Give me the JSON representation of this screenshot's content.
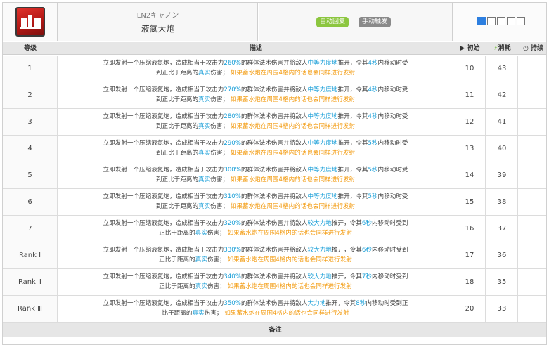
{
  "header": {
    "name_jp": "LN2キャノン",
    "name_cn": "液氮大炮",
    "badge_auto": "自动回复",
    "badge_manual": "手动触发",
    "level_selector": {
      "active": 1,
      "total": 5
    }
  },
  "columns": {
    "level": "等级",
    "description": "描述",
    "initial": "初始",
    "cost": "消耗",
    "duration": "持续"
  },
  "rows": [
    {
      "level": "1",
      "a": "立即发射一个压缩液氮炮，造成相当于攻击力",
      "pct": "260%",
      "b": "的群体法术伤害并将敌人",
      "force": "中等力度地",
      "c": "推开，令其",
      "sec": "4秒",
      "d": "内移动时受",
      "e": "到正比于距离的",
      "true": "真实",
      "f": "伤害；",
      "g": "如果蓄水炮在周围4格内的话也会同样进行发射",
      "initial": "10",
      "cost": "43",
      "duration": ""
    },
    {
      "level": "2",
      "a": "立即发射一个压缩液氮炮，造成相当于攻击力",
      "pct": "270%",
      "b": "的群体法术伤害并将敌人",
      "force": "中等力度地",
      "c": "推开，令其",
      "sec": "4秒",
      "d": "内移动时受",
      "e": "到正比于距离的",
      "true": "真实",
      "f": "伤害；",
      "g": "如果蓄水炮在周围4格内的话也会同样进行发射",
      "initial": "11",
      "cost": "42",
      "duration": ""
    },
    {
      "level": "3",
      "a": "立即发射一个压缩液氮炮，造成相当于攻击力",
      "pct": "280%",
      "b": "的群体法术伤害并将敌人",
      "force": "中等力度地",
      "c": "推开，令其",
      "sec": "4秒",
      "d": "内移动时受",
      "e": "到正比于距离的",
      "true": "真实",
      "f": "伤害；",
      "g": "如果蓄水炮在周围4格内的话也会同样进行发射",
      "initial": "12",
      "cost": "41",
      "duration": ""
    },
    {
      "level": "4",
      "a": "立即发射一个压缩液氮炮，造成相当于攻击力",
      "pct": "290%",
      "b": "的群体法术伤害并将敌人",
      "force": "中等力度地",
      "c": "推开，令其",
      "sec": "5秒",
      "d": "内移动时受",
      "e": "到正比于距离的",
      "true": "真实",
      "f": "伤害；",
      "g": "如果蓄水炮在周围4格内的话也会同样进行发射",
      "initial": "13",
      "cost": "40",
      "duration": ""
    },
    {
      "level": "5",
      "a": "立即发射一个压缩液氮炮，造成相当于攻击力",
      "pct": "300%",
      "b": "的群体法术伤害并将敌人",
      "force": "中等力度地",
      "c": "推开，令其",
      "sec": "5秒",
      "d": "内移动时受",
      "e": "到正比于距离的",
      "true": "真实",
      "f": "伤害；",
      "g": "如果蓄水炮在周围4格内的话也会同样进行发射",
      "initial": "14",
      "cost": "39",
      "duration": ""
    },
    {
      "level": "6",
      "a": "立即发射一个压缩液氮炮，造成相当于攻击力",
      "pct": "310%",
      "b": "的群体法术伤害并将敌人",
      "force": "中等力度地",
      "c": "推开，令其",
      "sec": "5秒",
      "d": "内移动时受",
      "e": "到正比于距离的",
      "true": "真实",
      "f": "伤害；",
      "g": "如果蓄水炮在周围4格内的话也会同样进行发射",
      "initial": "15",
      "cost": "38",
      "duration": ""
    },
    {
      "level": "7",
      "a": "立即发射一个压缩液氮炮，造成相当于攻击力",
      "pct": "320%",
      "b": "的群体法术伤害并将敌人",
      "force": "较大力地",
      "c": "推开，令其",
      "sec": "6秒",
      "d": "内移动时受到",
      "e": "正比于距离的",
      "true": "真实",
      "f": "伤害；",
      "g": "如果蓄水炮在周围4格内的话也会同样进行发射",
      "initial": "16",
      "cost": "37",
      "duration": ""
    },
    {
      "level": "Rank Ⅰ",
      "a": "立即发射一个压缩液氮炮，造成相当于攻击力",
      "pct": "330%",
      "b": "的群体法术伤害并将敌人",
      "force": "较大力地",
      "c": "推开，令其",
      "sec": "6秒",
      "d": "内移动时受到",
      "e": "正比于距离的",
      "true": "真实",
      "f": "伤害；",
      "g": "如果蓄水炮在周围4格内的话也会同样进行发射",
      "initial": "17",
      "cost": "36",
      "duration": ""
    },
    {
      "level": "Rank Ⅱ",
      "a": "立即发射一个压缩液氮炮，造成相当于攻击力",
      "pct": "340%",
      "b": "的群体法术伤害并将敌人",
      "force": "较大力地",
      "c": "推开，令其",
      "sec": "7秒",
      "d": "内移动时受到",
      "e": "正比于距离的",
      "true": "真实",
      "f": "伤害；",
      "g": "如果蓄水炮在周围4格内的话也会同样进行发射",
      "initial": "18",
      "cost": "35",
      "duration": ""
    },
    {
      "level": "Rank Ⅲ",
      "a": "立即发射一个压缩液氮炮，造成相当于攻击力",
      "pct": "350%",
      "b": "的群体法术伤害并将敌人",
      "force": "大力地",
      "c": "推开，令其",
      "sec": "8秒",
      "d": "内移动时受到正",
      "e": "比于距离的",
      "true": "真实",
      "f": "伤害；",
      "g": "如果蓄水炮在周围4格内的话也会同样进行发射",
      "initial": "20",
      "cost": "33",
      "duration": ""
    }
  ],
  "notes_label": "备注",
  "colors": {
    "accent_blue": "#1a9fd8",
    "accent_orange": "#f39c12",
    "badge_green": "#8cc63f",
    "badge_gray": "#8a8a8a"
  }
}
